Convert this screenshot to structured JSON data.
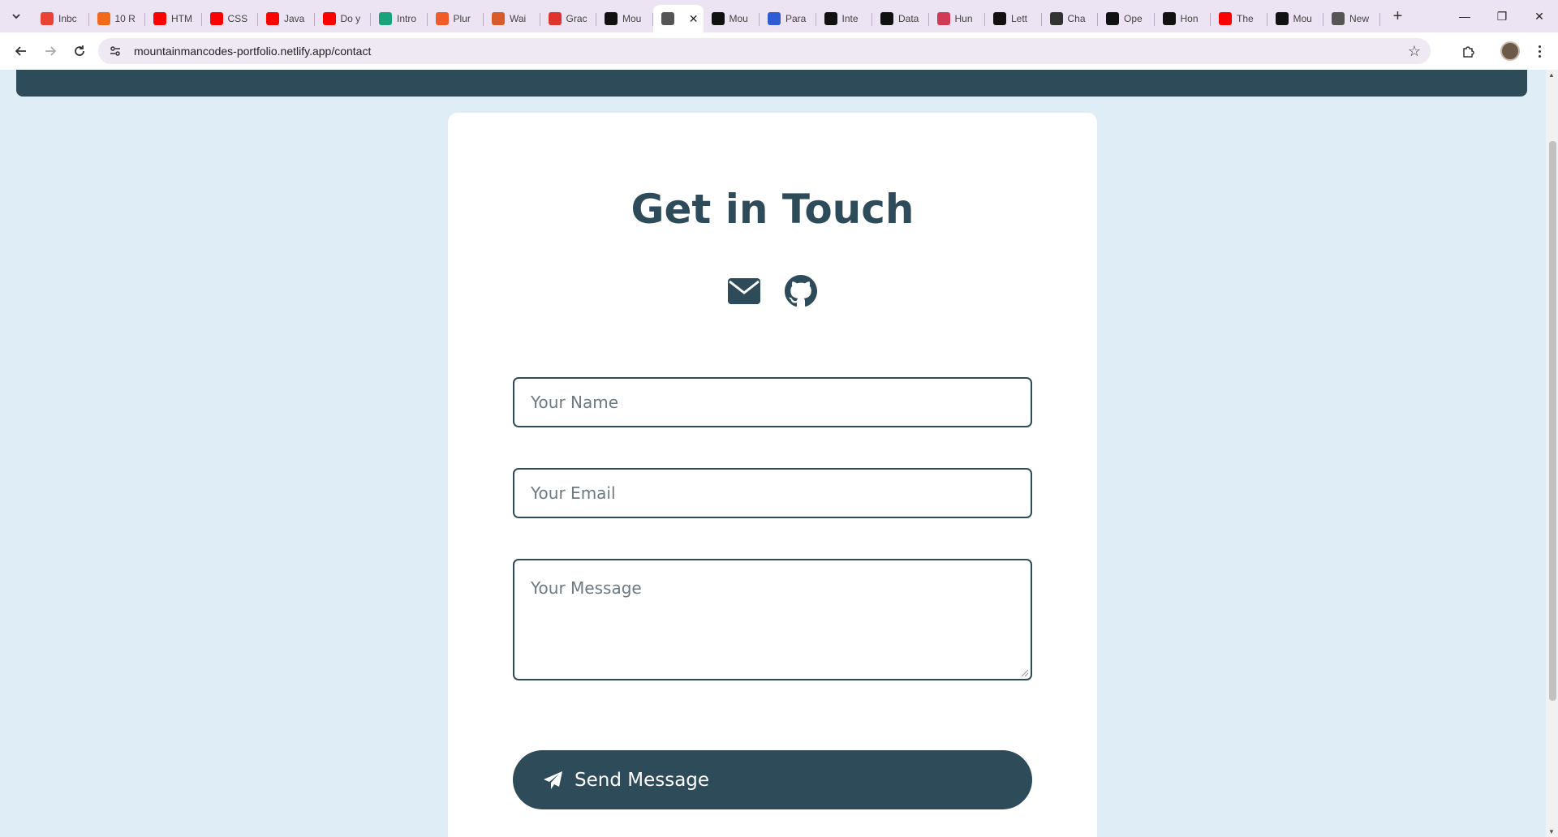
{
  "browser": {
    "tabs": [
      {
        "label": "Inbc",
        "icon": "gmail-icon",
        "color": "#ea4335"
      },
      {
        "label": "10 R",
        "icon": "bookmark-icon",
        "color": "#f26b1d"
      },
      {
        "label": "HTM",
        "icon": "youtube-icon",
        "color": "#ff0000"
      },
      {
        "label": "CSS",
        "icon": "youtube-icon",
        "color": "#ff0000"
      },
      {
        "label": "Java",
        "icon": "youtube-icon",
        "color": "#ff0000"
      },
      {
        "label": "Do y",
        "icon": "youtube-icon",
        "color": "#ff0000"
      },
      {
        "label": "Intro",
        "icon": "shield-icon",
        "color": "#1aa37a"
      },
      {
        "label": "Plur",
        "icon": "pluralsight-icon",
        "color": "#f15b2a"
      },
      {
        "label": "Wai",
        "icon": "star-burst-icon",
        "color": "#d95a2b"
      },
      {
        "label": "Grac",
        "icon": "ring-icon",
        "color": "#e0342f"
      },
      {
        "label": "Mou",
        "icon": "github-icon",
        "color": "#111111"
      },
      {
        "label": "",
        "icon": "globe-icon",
        "color": "#555555",
        "active": true
      },
      {
        "label": "Mou",
        "icon": "github-icon",
        "color": "#111111"
      },
      {
        "label": "Para",
        "icon": "parabola-icon",
        "color": "#2f5bd3"
      },
      {
        "label": "Inte",
        "icon": "if-icon",
        "color": "#111111"
      },
      {
        "label": "Data",
        "icon": "data-icon",
        "color": "#111111"
      },
      {
        "label": "Hun",
        "icon": "function-icon",
        "color": "#d13a56"
      },
      {
        "label": "Lett",
        "icon": "amazon-icon",
        "color": "#111111"
      },
      {
        "label": "Cha",
        "icon": "openai-icon",
        "color": "#333333"
      },
      {
        "label": "Ope",
        "icon": "openai-icon",
        "color": "#111111"
      },
      {
        "label": "Hon",
        "icon": "anthropic-icon",
        "color": "#111111"
      },
      {
        "label": "The",
        "icon": "youtube-icon",
        "color": "#ff0000"
      },
      {
        "label": "Mou",
        "icon": "github-icon",
        "color": "#111111"
      },
      {
        "label": "New",
        "icon": "chrome-icon",
        "color": "#555555"
      }
    ],
    "url": "mountainmancodes-portfolio.netlify.app/contact"
  },
  "page": {
    "title": "Get in Touch",
    "form": {
      "name_placeholder": "Your Name",
      "email_placeholder": "Your Email",
      "message_placeholder": "Your Message",
      "submit_label": "Send Message"
    }
  },
  "colors": {
    "primary": "#2e4b5a",
    "background": "#dfeef6"
  }
}
